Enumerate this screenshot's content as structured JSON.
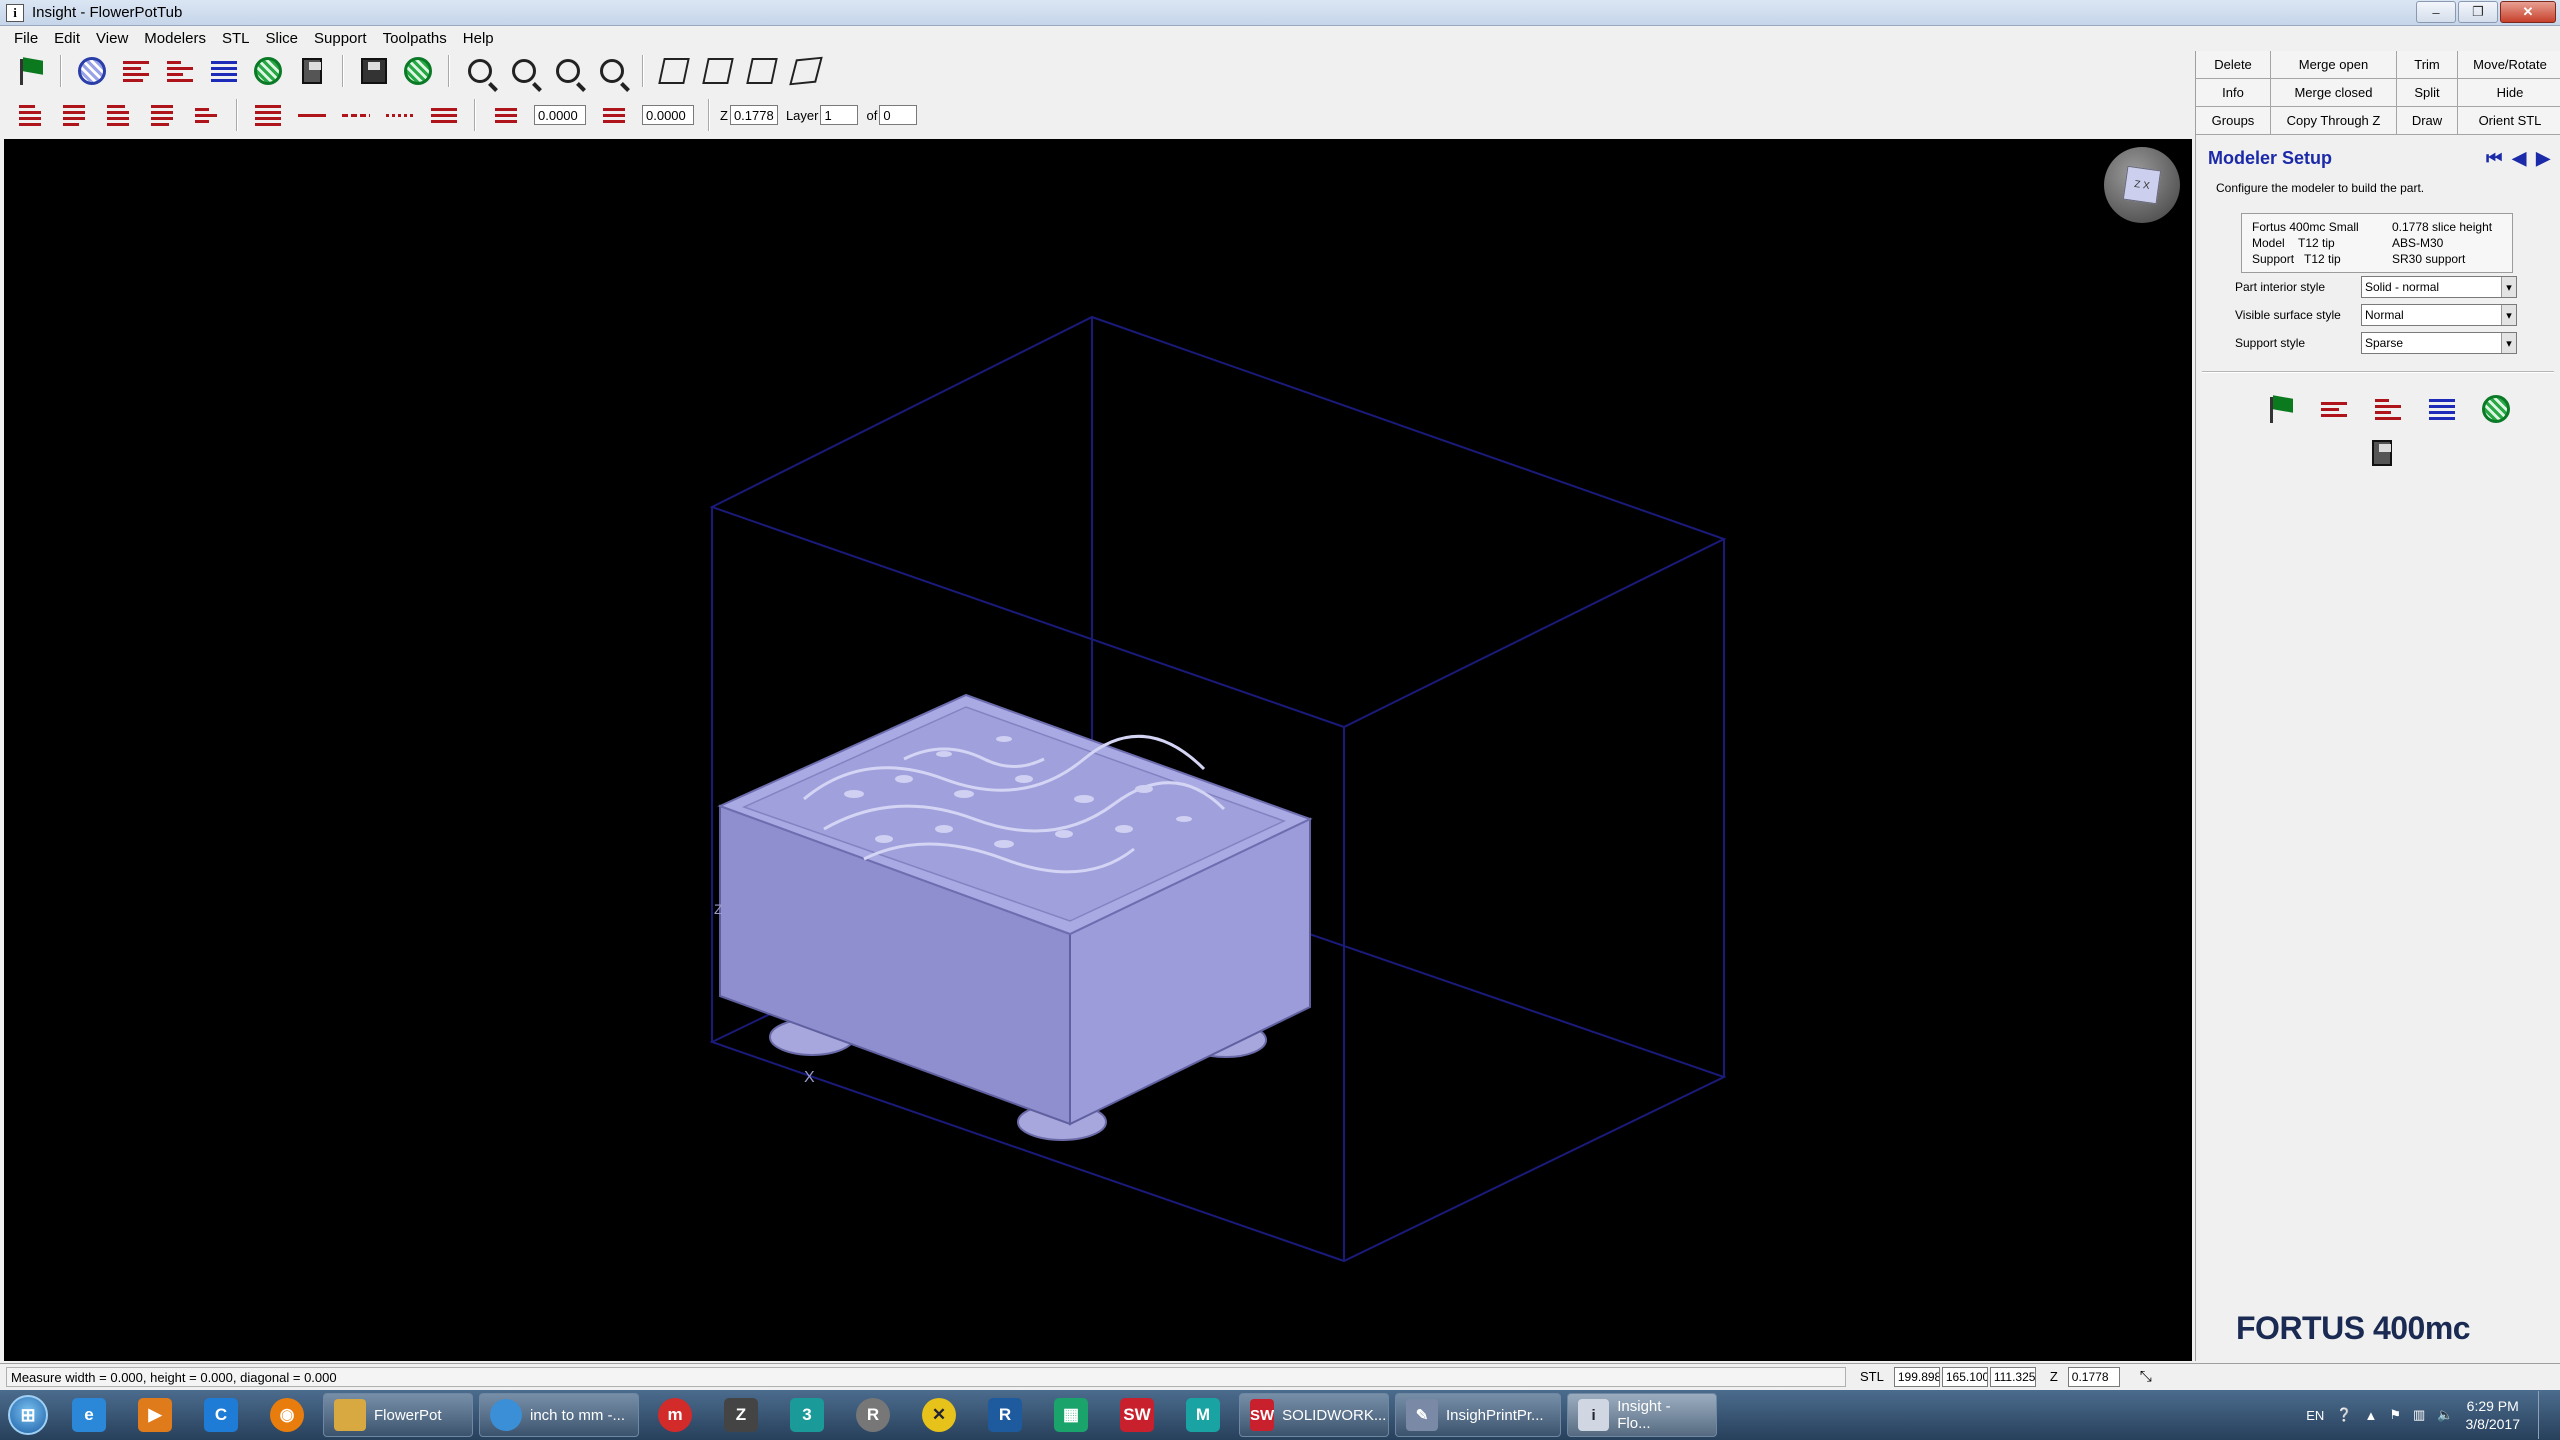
{
  "window": {
    "title": "Insight - FlowerPotTub",
    "app_icon": "i",
    "minimize": "–",
    "restore": "❐",
    "close": "✕"
  },
  "menu": [
    "File",
    "Edit",
    "View",
    "Modelers",
    "STL",
    "Slice",
    "Support",
    "Toolpaths",
    "Help"
  ],
  "toolbar2": {
    "offset1": "0.0000",
    "offset2": "0.0000",
    "z_label": "Z",
    "z_value": "0.1778",
    "layer_label": "Layer",
    "layer_value": "1",
    "of_label": "of",
    "of_value": "0"
  },
  "viewport": {
    "axis_x": "X",
    "axis_z": "Z",
    "cube_label": "Z X",
    "part_color": "#9a9ad6",
    "envelope_color": "#1a1a7a"
  },
  "commands": [
    [
      "Delete",
      "Merge open",
      "Trim",
      "Move/Rotate"
    ],
    [
      "Info",
      "Merge closed",
      "Split",
      "Hide"
    ],
    [
      "Groups",
      "Copy Through Z",
      "Draw",
      "Orient STL"
    ]
  ],
  "modeler": {
    "title": "Modeler Setup",
    "description": "Configure the modeler to build the part.",
    "printer": {
      "model_name": "Fortus 400mc Small",
      "slice_height": "0.1778 slice height",
      "model_label": "Model",
      "model_tip": "T12 tip",
      "model_material": "ABS-M30",
      "support_label": "Support",
      "support_tip": "T12 tip",
      "support_material": "SR30 support"
    },
    "part_interior_label": "Part interior style",
    "part_interior_value": "Solid - normal",
    "visible_surface_label": "Visible surface style",
    "visible_surface_value": "Normal",
    "support_style_label": "Support style",
    "support_style_value": "Sparse",
    "logo": "FORTUS 400mc"
  },
  "status": {
    "measure": "Measure width = 0.000, height = 0.000, diagonal = 0.000",
    "stl_label": "STL",
    "stl_x": "199.898",
    "stl_y": "165.100",
    "stl_z": "111.325",
    "z_label": "Z",
    "z_value": "0.1778"
  },
  "taskbar": {
    "buttons": [
      {
        "label": "FlowerPot",
        "color": "#d9a941"
      },
      {
        "label": "inch to mm -...",
        "color": "#3b8fd6"
      },
      {
        "label": "SOLIDWORK...",
        "color": "#c8202d"
      },
      {
        "label": "InsighPrintPr...",
        "color": "#7a8aa6"
      },
      {
        "label": "Insight - Flo...",
        "color": "#d0d6e2"
      }
    ],
    "language": "EN",
    "time": "6:29 PM",
    "date": "3/8/2017"
  }
}
